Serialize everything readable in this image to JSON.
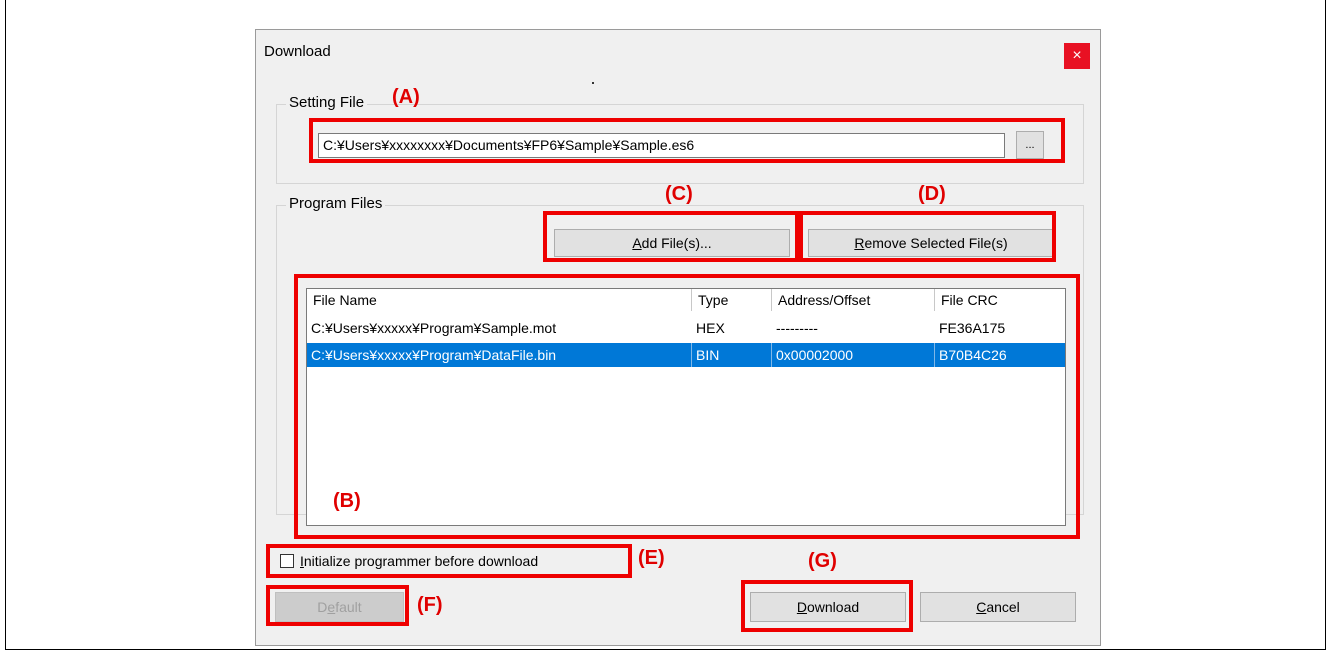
{
  "window": {
    "title": "Download",
    "close_glyph": "×"
  },
  "setting_file": {
    "label": "Setting File",
    "path_value": "C:¥Users¥xxxxxxxx¥Documents¥FP6¥Sample¥Sample.es6",
    "browse_label": "..."
  },
  "program_files": {
    "label": "Program Files",
    "add_button": {
      "mnemonic": "A",
      "rest": "dd File(s)..."
    },
    "remove_button": {
      "mnemonic": "R",
      "rest": "emove Selected File(s)"
    },
    "table": {
      "columns": [
        "File Name",
        "Type",
        "Address/Offset",
        "File CRC"
      ],
      "rows": [
        {
          "file": "C:¥Users¥xxxxx¥Program¥Sample.mot",
          "type": "HEX",
          "address": "---------",
          "crc": "FE36A175"
        },
        {
          "file": "C:¥Users¥xxxxx¥Program¥DataFile.bin",
          "type": "BIN",
          "address": "0x00002000",
          "crc": "B70B4C26"
        }
      ],
      "selected_row": 1
    }
  },
  "init_checkbox": {
    "mnemonic": "I",
    "rest": "nitialize programmer before download",
    "checked": false
  },
  "buttons": {
    "default": {
      "pre": "D",
      "mnemonic": "e",
      "rest": "fault",
      "enabled": false
    },
    "download": {
      "mnemonic": "D",
      "rest": "ownload"
    },
    "cancel": {
      "mnemonic": "C",
      "rest": "ancel"
    }
  },
  "callouts": {
    "A": "(A)",
    "B": "(B)",
    "C": "(C)",
    "D": "(D)",
    "E": "(E)",
    "F": "(F)",
    "G": "(G)"
  },
  "colors": {
    "highlight": "#ee0000",
    "selection": "#0078d7",
    "close": "#e81123"
  },
  "icons": {
    "close": "close-icon"
  }
}
